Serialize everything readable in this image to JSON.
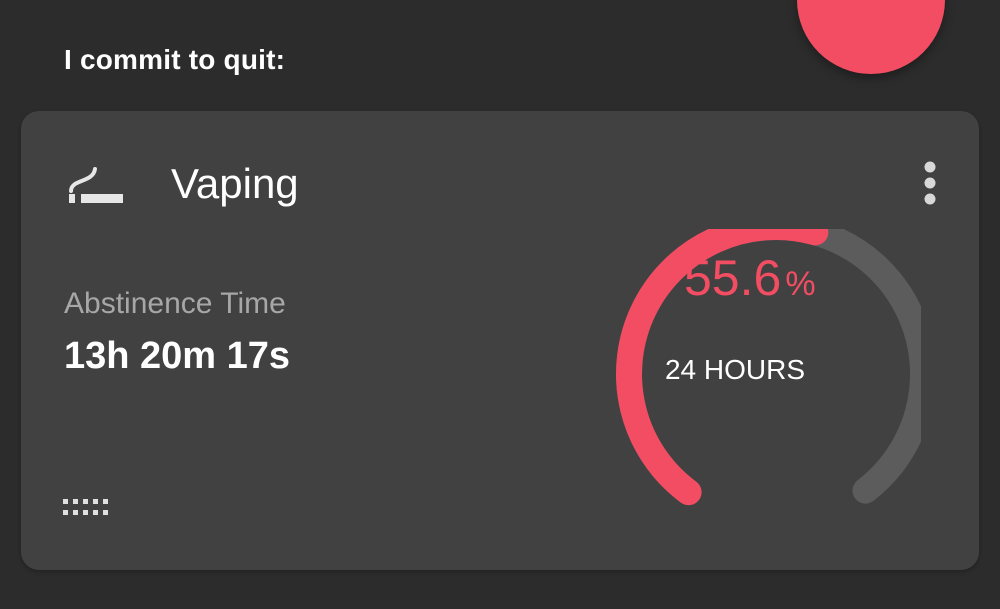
{
  "header": {
    "title": "I commit to quit:"
  },
  "fab": {
    "icon": "plus-icon",
    "color": "#f24d62"
  },
  "habit_card": {
    "name": "Vaping",
    "icon": "smoking-icon",
    "menu_icon": "more-vert-icon",
    "metric_label": "Abstinence Time",
    "metric_value": "13h 20m 17s",
    "drag_handle_icon": "drag-handle-icon",
    "progress": {
      "value": "55.6",
      "unit": "%",
      "fraction": 0.556,
      "caption": "24 HOURS",
      "color": "#f24d62",
      "track_color": "#5c5c5c"
    }
  },
  "colors": {
    "background": "#2c2c2c",
    "card": "#414141",
    "accent": "#f24d62"
  }
}
